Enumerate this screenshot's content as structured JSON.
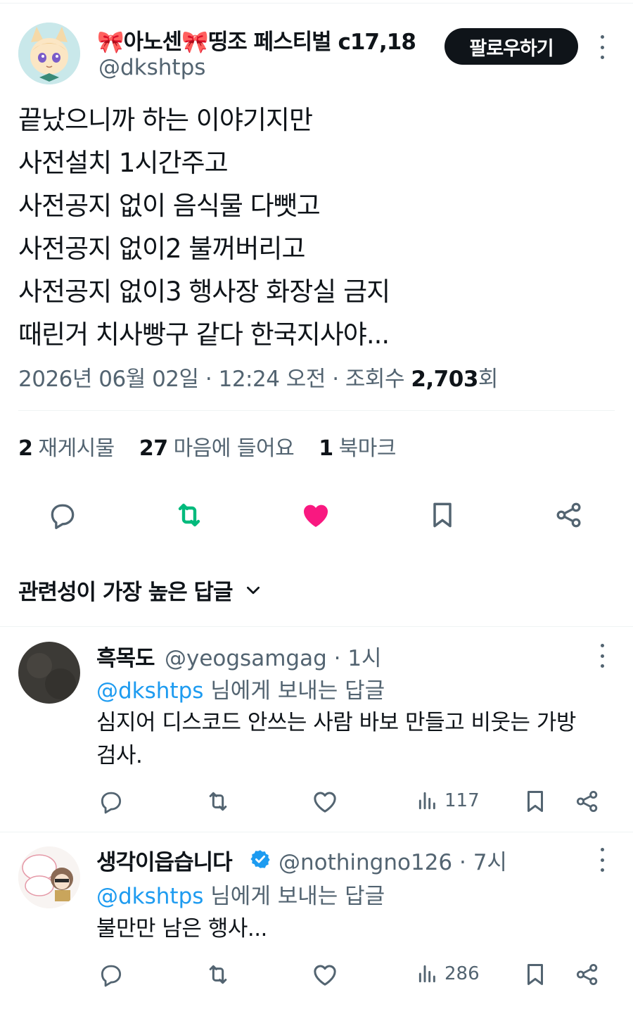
{
  "tweet": {
    "author": {
      "display_name": "🎀아노센🎀띵조 페스티벌 c17,18",
      "handle": "@dkshtps"
    },
    "follow_label": "팔로우하기",
    "lines": [
      "끝났으니까 하는 이야기지만",
      "사전설치  1시간주고",
      "사전공지 없이 음식물 다뺏고",
      "사전공지 없이2 불꺼버리고",
      "사전공지 없이3 행사장 화장실 금지",
      "때린거 치사빵구 같다 한국지사야..."
    ],
    "meta": {
      "date_time": "2026년 06월 02일 · 12:24 오전 · 조회수 ",
      "views": "2,703",
      "views_suffix": "회"
    },
    "stats": {
      "reposts_count": "2",
      "reposts_label": "재게시물",
      "likes_count": "27",
      "likes_label": "마음에 들어요",
      "bookmarks_count": "1",
      "bookmarks_label": "북마크"
    },
    "icons": [
      "reply-icon",
      "repost-icon",
      "like-icon",
      "bookmark-icon",
      "share-icon"
    ],
    "colors": {
      "repost": "#00ba7c",
      "like": "#f91880",
      "follow_bg": "#0f1419"
    }
  },
  "sort_label": "관련성이 가장 높은 답글",
  "replies": [
    {
      "display_name": "흑목도",
      "handle": "@yeogsamgag · 1시",
      "reply_mention": "@dkshtps",
      "reply_to_suffix": " 님에게 보내는 답글",
      "text": "심지어 디스코드 안쓰는 사람 바보 만들고 비웃는 가방검사.",
      "views": "117"
    },
    {
      "display_name": "생각이읍습니다",
      "verified": true,
      "handle": "@nothingno126 · 7시",
      "reply_mention": "@dkshtps",
      "reply_to_suffix": " 님에게 보내는 답글",
      "text": "불만만 남은 행사...",
      "views": "286"
    }
  ]
}
